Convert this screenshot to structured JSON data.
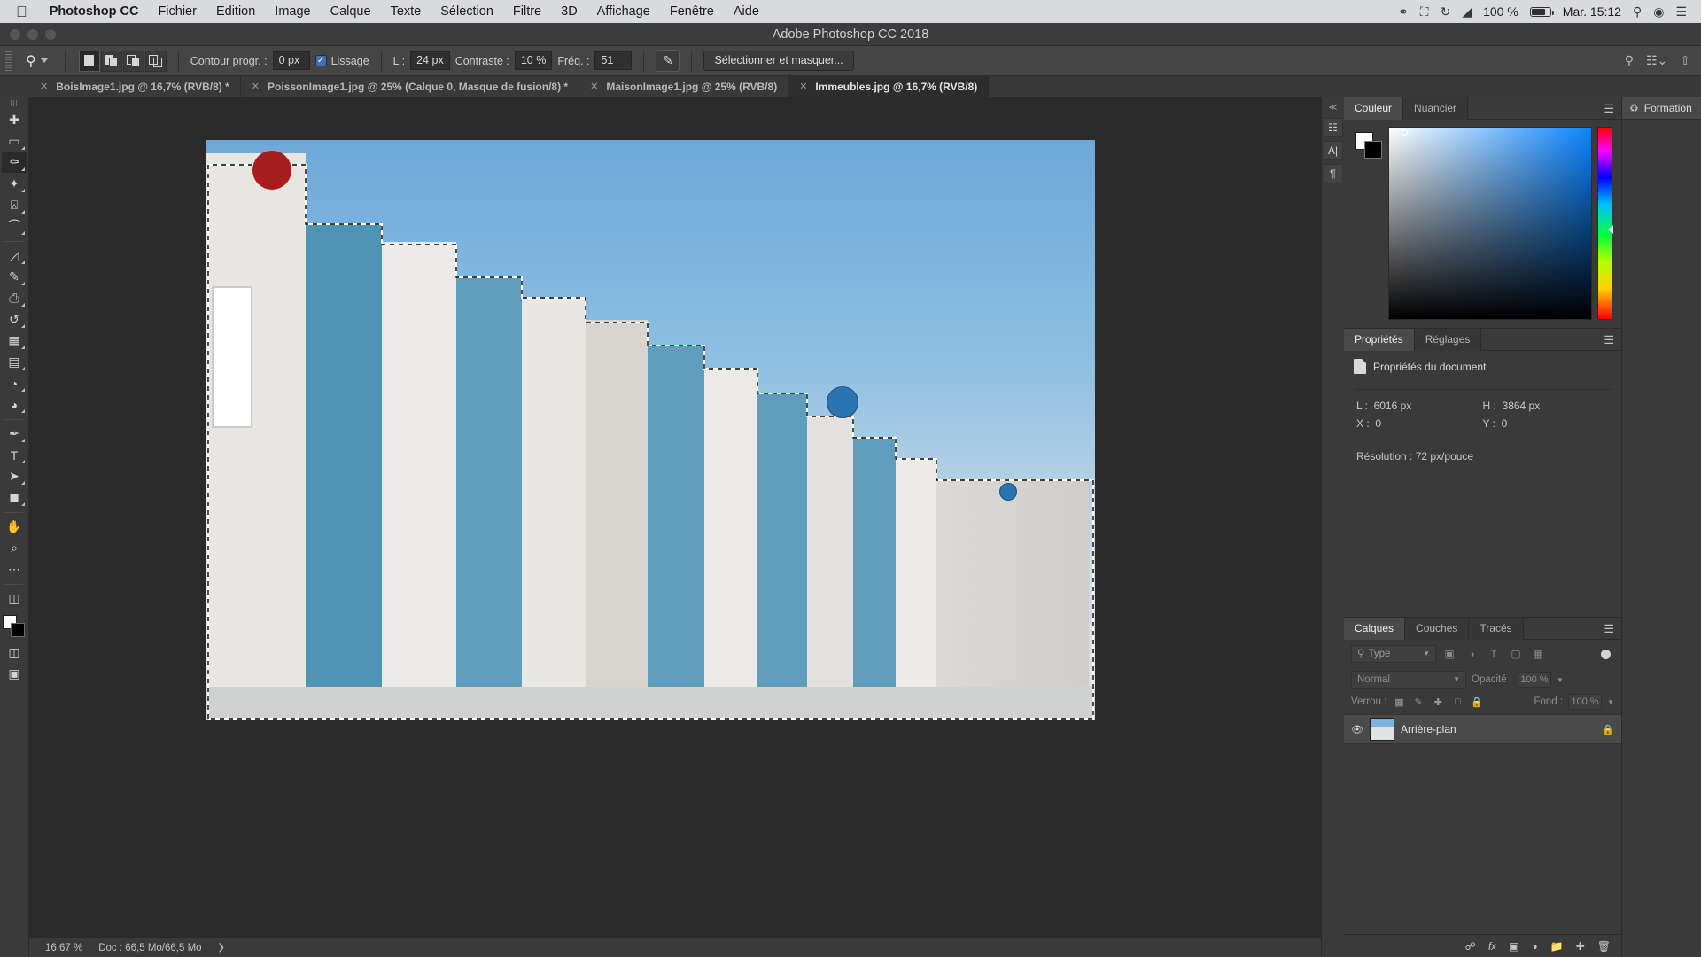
{
  "mac_menubar": {
    "apple_icon": "apple-logo",
    "items": [
      "Photoshop CC",
      "Fichier",
      "Edition",
      "Image",
      "Calque",
      "Texte",
      "Sélection",
      "Filtre",
      "3D",
      "Affichage",
      "Fenêtre",
      "Aide"
    ],
    "right": {
      "creative_cloud_icon": "creative-cloud-icon",
      "airplay_icon": "airplay-icon",
      "timemachine_icon": "time-machine-icon",
      "wifi_icon": "wifi-icon",
      "battery_percent": "100 %",
      "battery_icon": "battery-icon",
      "clock": "Mar. 15:12",
      "search_icon": "spotlight-search-icon",
      "siri_icon": "siri-icon",
      "control_center_icon": "menu-list-icon"
    }
  },
  "titlebar": {
    "title": "Adobe Photoshop CC 2018"
  },
  "options_bar": {
    "tool_icon": "lasso-magnetic-icon",
    "selection_modes": [
      "new-selection",
      "add-to-selection",
      "subtract-from-selection",
      "intersect-selection"
    ],
    "feather_label": "Contour progr. :",
    "feather_value": "0 px",
    "antialias_label": "Lissage",
    "antialias_checked": true,
    "width_label": "L :",
    "width_value": "24 px",
    "contrast_label": "Contraste :",
    "contrast_value": "10 %",
    "frequency_label": "Fréq. :",
    "frequency_value": "51",
    "pressure_icon": "pen-pressure-icon",
    "refine_button": "Sélectionner et masquer...",
    "right_icons": [
      "search-icon",
      "workspace-switcher-icon",
      "share-icon"
    ]
  },
  "tabs": [
    {
      "name": "BoisImage1.jpg @ 16,7% (RVB/8) *",
      "active": false
    },
    {
      "name": "PoissonImage1.jpg @ 25% (Calque 0, Masque de fusion/8) *",
      "active": false
    },
    {
      "name": "MaisonImage1.jpg @ 25% (RVB/8)",
      "active": false
    },
    {
      "name": "Immeubles.jpg @ 16,7% (RVB/8)",
      "active": true
    }
  ],
  "toolbox": {
    "tools": [
      {
        "name": "move-tool",
        "glyph": "✥",
        "active": false
      },
      {
        "name": "rectangular-marquee-tool",
        "glyph": "▭",
        "active": false
      },
      {
        "name": "lasso-tool",
        "glyph": "✍",
        "active": true
      },
      {
        "name": "magic-wand-tool",
        "glyph": "✦",
        "active": false
      },
      {
        "name": "crop-tool",
        "glyph": "⌗",
        "active": false
      },
      {
        "name": "eyedropper-tool",
        "glyph": "⌁",
        "active": false
      },
      {
        "name": "spot-healing-brush-tool",
        "glyph": "✚",
        "active": false
      },
      {
        "name": "brush-tool",
        "glyph": "🖌",
        "active": false
      },
      {
        "name": "clone-stamp-tool",
        "glyph": "⎙",
        "active": false
      },
      {
        "name": "history-brush-tool",
        "glyph": "↺",
        "active": false
      },
      {
        "name": "eraser-tool",
        "glyph": "◨",
        "active": false
      },
      {
        "name": "gradient-tool",
        "glyph": "▤",
        "active": false
      },
      {
        "name": "blur-tool",
        "glyph": "◍",
        "active": false
      },
      {
        "name": "dodge-tool",
        "glyph": "◔",
        "active": false
      },
      {
        "name": "pen-tool",
        "glyph": "✒",
        "active": false
      },
      {
        "name": "type-tool",
        "glyph": "T",
        "active": false
      },
      {
        "name": "path-selection-tool",
        "glyph": "➤",
        "active": false
      },
      {
        "name": "hand-tool",
        "glyph": "✋",
        "active": false
      },
      {
        "name": "zoom-tool",
        "glyph": "⌕",
        "active": false
      },
      {
        "name": "more-tools",
        "glyph": "•••",
        "active": false
      },
      {
        "name": "quick-mask-tool",
        "glyph": "◫",
        "active": false
      },
      {
        "name": "screen-mode-tool",
        "glyph": "▣",
        "active": false
      },
      {
        "name": "screen-mode-full-tool",
        "glyph": "▦",
        "active": false
      }
    ],
    "foreground_color": "#ffffff",
    "background_color": "#000000"
  },
  "document": {
    "zoom": "16,67 %",
    "doc_size": "Doc : 66,5 Mo/66,5 Mo",
    "status_arrow": "chevron-right-icon"
  },
  "color_panel": {
    "tabs": [
      {
        "label": "Couleur",
        "active": true
      },
      {
        "label": "Nuancier",
        "active": false
      }
    ],
    "menu_icon": "panel-menu-icon",
    "foreground_swatch": "#ffffff",
    "background_swatch": "#000000",
    "hue_marker_position": "110"
  },
  "properties_panel": {
    "tabs": [
      {
        "label": "Propriétés",
        "active": true
      },
      {
        "label": "Réglages",
        "active": false
      }
    ],
    "menu_icon": "panel-menu-icon",
    "header": "Propriétés du document",
    "header_icon": "document-icon",
    "rows": [
      {
        "left_label": "L :",
        "left_value": "6016 px",
        "right_label": "H :",
        "right_value": "3864 px"
      },
      {
        "left_label": "X :",
        "left_value": "0",
        "right_label": "Y :",
        "right_value": "0"
      }
    ],
    "resolution": "Résolution : 72 px/pouce"
  },
  "layers_panel": {
    "tabs": [
      {
        "label": "Calques",
        "active": true
      },
      {
        "label": "Couches",
        "active": false
      },
      {
        "label": "Tracés",
        "active": false
      }
    ],
    "menu_icon": "panel-menu-icon",
    "filter_kind_label": "Type",
    "filter_search_icon": "search-icon",
    "filter_icons": [
      "pixel-filter-icon",
      "adjustment-filter-icon",
      "type-filter-icon",
      "shape-filter-icon",
      "smart-object-filter-icon"
    ],
    "filter_toggle": "filter-enable-toggle",
    "blend_mode": "Normal",
    "opacity_label": "Opacité :",
    "opacity_value": "100 %",
    "lock_label": "Verrou :",
    "lock_icons": [
      "lock-transparent-pixels-icon",
      "lock-image-pixels-icon",
      "lock-position-icon",
      "lock-artboard-icon",
      "lock-all-icon"
    ],
    "fill_label": "Fond :",
    "fill_value": "100 %",
    "layers": [
      {
        "name": "Arrière-plan",
        "visible": true,
        "locked": true,
        "eye_icon": "eye-icon",
        "lock_icon": "lock-icon"
      }
    ],
    "footer_icons": [
      "link-layers-icon",
      "layer-style-fx-icon",
      "layer-mask-icon",
      "new-adjustment-layer-icon",
      "new-group-icon",
      "new-layer-icon",
      "delete-layer-icon"
    ]
  },
  "formation_panel": {
    "label": "Formation",
    "icon": "graduation-cap-icon"
  },
  "mini_dock": {
    "buttons": [
      "libraries-icon",
      "character-icon",
      "paragraph-icon"
    ],
    "expand_icon": "chevron-double-left-icon"
  },
  "canvas_art": {
    "description": "Row of white and blue modernist apartment buildings against a blue sky with an active marching-ants selection around the rooftops",
    "selection_active": true,
    "sky_color": "#7fb2dc",
    "building_white": "#e6e4e0",
    "building_blue": "#5e9bbd",
    "marker_dots": [
      {
        "name": "red-dot",
        "color": "#a81d1d"
      },
      {
        "name": "blue-dot-large",
        "color": "#2a74b4"
      },
      {
        "name": "blue-dot-small",
        "color": "#2a74b4"
      }
    ]
  }
}
